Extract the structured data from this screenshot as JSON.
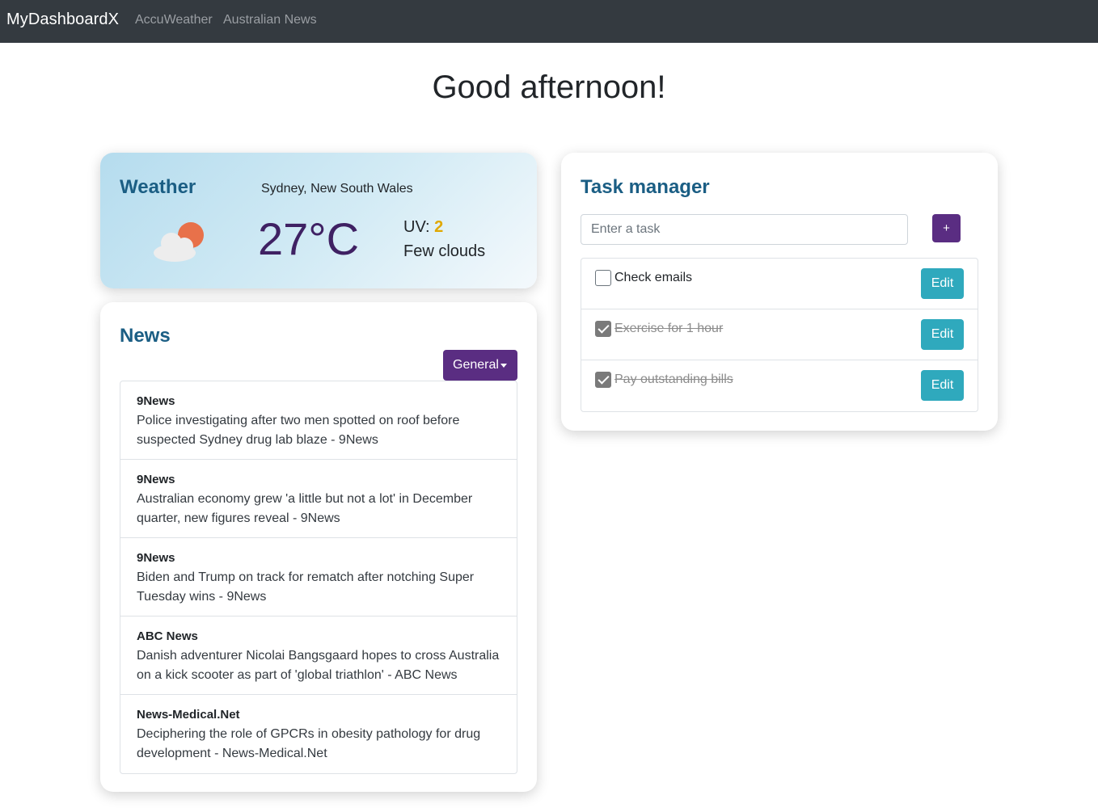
{
  "navbar": {
    "brand": "MyDashboardX",
    "links": [
      "AccuWeather",
      "Australian News"
    ]
  },
  "greeting": "Good afternoon!",
  "weather": {
    "title": "Weather",
    "location": "Sydney, New South Wales",
    "temperature": "27°C",
    "uv_label": "UV:",
    "uv_value": "2",
    "description": "Few clouds",
    "icon": "cloud-sun-icon"
  },
  "news": {
    "title": "News",
    "category": "General",
    "items": [
      {
        "source": "9News",
        "headline": "Police investigating after two men spotted on roof before suspected Sydney drug lab blaze - 9News"
      },
      {
        "source": "9News",
        "headline": "Australian economy grew 'a little but not a lot' in December quarter, new figures reveal - 9News"
      },
      {
        "source": "9News",
        "headline": "Biden and Trump on track for rematch after notching Super Tuesday wins - 9News"
      },
      {
        "source": "ABC News",
        "headline": "Danish adventurer Nicolai Bangsgaard hopes to cross Australia on a kick scooter as part of 'global triathlon' - ABC News"
      },
      {
        "source": "News-Medical.Net",
        "headline": "Deciphering the role of GPCRs in obesity pathology for drug development - News-Medical.Net"
      }
    ]
  },
  "tasks": {
    "title": "Task manager",
    "input_placeholder": "Enter a task",
    "add_label": "+",
    "edit_label": "Edit",
    "items": [
      {
        "label": "Check emails",
        "done": false
      },
      {
        "label": "Exercise for 1 hour",
        "done": true
      },
      {
        "label": "Pay outstanding bills",
        "done": true
      }
    ]
  },
  "colors": {
    "navbar": "#343a40",
    "accent": "#5a2d82",
    "title": "#1b5e84",
    "edit_button": "#2fa9bd",
    "uv": "#e0a800",
    "temperature": "#3f2163"
  }
}
